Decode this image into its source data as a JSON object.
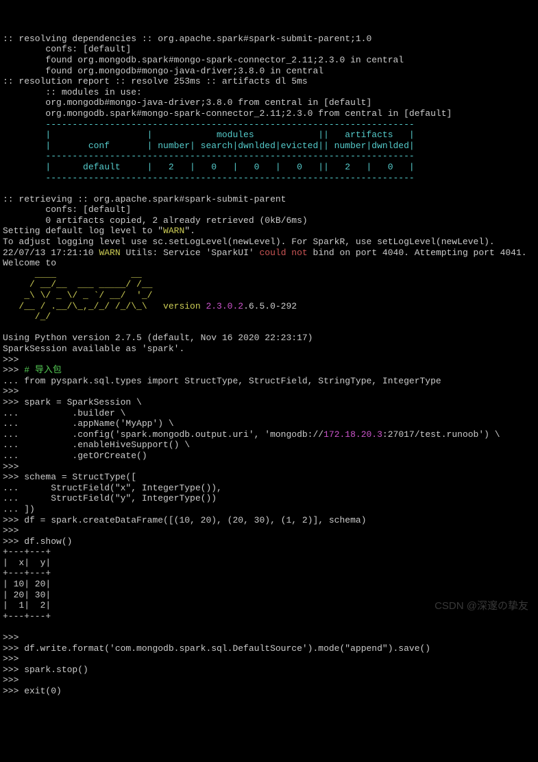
{
  "hdr": {
    "l01": ":: resolving dependencies :: org.apache.spark#spark-submit-parent;1.0",
    "l02": "        confs: [default]",
    "l03": "        found org.mongodb.spark#mongo-spark-connector_2.11;2.3.0 in central",
    "l04": "        found org.mongodb#mongo-java-driver;3.8.0 in central",
    "l05": ":: resolution report :: resolve 253ms :: artifacts dl 5ms",
    "l06": "        :: modules in use:",
    "l07": "        org.mongodb#mongo-java-driver;3.8.0 from central in [default]",
    "l08": "        org.mongodb.spark#mongo-spark-connector_2.11;2.3.0 from central in [default]",
    "t1": "        ---------------------------------------------------------------------",
    "t2": "        |                  |            modules            ||   artifacts   |",
    "t3": "        |       conf       | number| search|dwnlded|evicted|| number|dwnlded|",
    "t4": "        ---------------------------------------------------------------------",
    "t5": "        |      default     |   2   |   0   |   0   |   0   ||   2   |   0   |",
    "t6": "        ---------------------------------------------------------------------"
  },
  "ret": {
    "l1": ":: retrieving :: org.apache.spark#spark-submit-parent",
    "l2": "        confs: [default]",
    "l3": "        0 artifacts copied, 2 already retrieved (0kB/6ms)"
  },
  "warn": {
    "pre": "Setting default log level to \"",
    "w": "WARN",
    "post": "\".",
    "adj": "To adjust logging level use sc.setLogLevel(newLevel). For SparkR, use setLogLevel(newLevel).",
    "ts": "22/07/13 17:21:10 ",
    "wb": "WARN",
    "utilpre": " Utils: Service 'SparkUI' ",
    "cn": "could not",
    "utilpost": " bind on port 4040. Attempting port 4041."
  },
  "welcome": "Welcome to",
  "ascii": {
    "a1": "      ____              __",
    "a2": "     / __/__  ___ _____/ /__",
    "a3": "    _\\ \\/ _ \\/ _ `/ __/  '_/",
    "a4pre": "   /__ / .__/\\_,_/_/ /_/\\_\\   version ",
    "ver1": "2.3.0.2",
    "ver2": ".6.5.0-292",
    "a5": "      /_/"
  },
  "env": {
    "py": "Using Python version 2.7.5 (default, Nov 16 2020 22:23:17)",
    "ss": "SparkSession available as 'spark'."
  },
  "repl": {
    "p": ">>>",
    "c": "...",
    "cm": "# 导入包",
    "imp": " from pyspark.sql.types import StructType, StructField, StringType, IntegerType",
    "s1": " spark = SparkSession \\",
    "s2": "          .builder \\",
    "s3": "          .appName('MyApp') \\",
    "s4a": "          .config('spark.mongodb.output.uri', 'mongodb://",
    "s4ip": "172.18.20.3",
    "s4b": ":27017/test.runoob') \\",
    "s5": "          .enableHiveSupport() \\",
    "s6": "          .getOrCreate()",
    "sch1": " schema = StructType([",
    "sch2": "      StructField(\"x\", IntegerType()),",
    "sch3": "      StructField(\"y\", IntegerType())",
    "sch4": " ])",
    "df": " df = spark.createDataFrame([(10, 20), (20, 30), (1, 2)], schema)",
    "show": " df.show()",
    "tbl1": "+---+---+",
    "tbl2": "|  x|  y|",
    "tbl3": "+---+---+",
    "tbl4": "| 10| 20|",
    "tbl5": "| 20| 30|",
    "tbl6": "|  1|  2|",
    "tbl7": "+---+---+",
    "wr": " df.write.format('com.mongodb.spark.sql.DefaultSource').mode(\"append\").save()",
    "stop": " spark.stop()",
    "exit": " exit(0)"
  },
  "watermark": "CSDN @深邃の挚友"
}
